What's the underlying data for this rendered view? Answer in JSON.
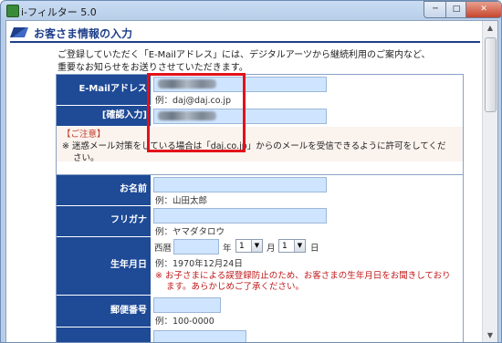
{
  "window": {
    "title": "i-フィルター 5.0",
    "min": "─",
    "max": "□",
    "close": "✕"
  },
  "page": {
    "header": "お客さま情報の入力",
    "intro_line1": "ご登録していただく「E-Mailアドレス」には、デジタルアーツから継続利用のご案内など、",
    "intro_line2": "重要なお知らせをお送りさせていただきます。"
  },
  "email_section": {
    "email_label": "E-Mailアドレス",
    "email_example": "例：daj@daj.co.jp",
    "confirm_label": "[確認入力]",
    "note_head": "【ご注意】",
    "note_line1": "※ 迷惑メール対策をしている場合は「daj.co.jp」からのメールを受信できるように許可をしてくだ",
    "note_line2": "さい。"
  },
  "personal_section": {
    "name_label": "お名前",
    "name_example": "例：山田太郎",
    "kana_label": "フリガナ",
    "kana_example": "例：ヤマダタロウ",
    "birth_label": "生年月日",
    "era": "西暦",
    "year_unit": "年",
    "month_value": "1",
    "month_unit": "月",
    "day_value": "1",
    "day_unit": "日",
    "birth_example": "例：1970年12月24日",
    "birth_note_line1": "※ お子さまによる誤登録防止のため、お客さまの生年月日をお聞きしており",
    "birth_note_line2": "ます。あらかじめご了承ください。",
    "zip_label": "郵便番号",
    "zip_example": "例：100-0000"
  },
  "colors": {
    "label_bg": "#1e4a96",
    "input_bg": "#cfe5ff",
    "highlight": "#e3111a",
    "note_text": "#c0181a"
  }
}
